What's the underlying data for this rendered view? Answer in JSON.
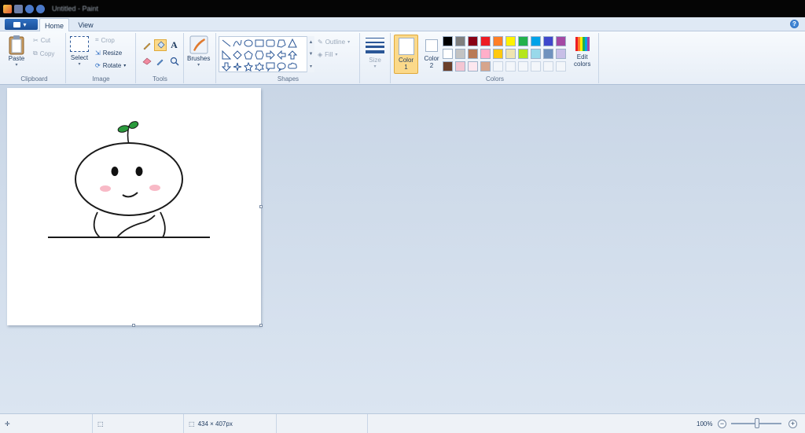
{
  "window": {
    "title": "Untitled - Paint"
  },
  "ribbon_tabs": {
    "file": "",
    "home": "Home",
    "view": "View"
  },
  "clipboard": {
    "label": "Clipboard",
    "paste": "Paste",
    "cut": "Cut",
    "copy": "Copy"
  },
  "image": {
    "label": "Image",
    "select": "Select",
    "crop": "Crop",
    "resize": "Resize",
    "rotate": "Rotate"
  },
  "tools": {
    "label": "Tools"
  },
  "brushes": {
    "label": "Brushes"
  },
  "shapes": {
    "label": "Shapes",
    "outline": "Outline",
    "fill": "Fill"
  },
  "size": {
    "label": "Size"
  },
  "colors": {
    "label": "Colors",
    "color1": "Color",
    "color1_num": "1",
    "color2": "Color",
    "color2_num": "2",
    "edit_line1": "Edit",
    "edit_line2": "colors",
    "palette": [
      "#000000",
      "#7f7f7f",
      "#880015",
      "#ed1c24",
      "#ff7f27",
      "#fff200",
      "#22b14c",
      "#00a2e8",
      "#3f48cc",
      "#a349a4",
      "#ffffff",
      "#c3c3c3",
      "#b97a57",
      "#ffaec9",
      "#ffc90e",
      "#efe4b0",
      "#b5e61d",
      "#99d9ea",
      "#7092be",
      "#c8bfe7",
      "#6b3f2a",
      "#f4c6d3",
      "#fde7ef",
      "#d6a58c",
      "",
      "",
      "",
      "",
      "",
      ""
    ],
    "accent": "#f7c25c"
  },
  "status": {
    "image_size": "434 × 407px",
    "zoom": "100%"
  }
}
